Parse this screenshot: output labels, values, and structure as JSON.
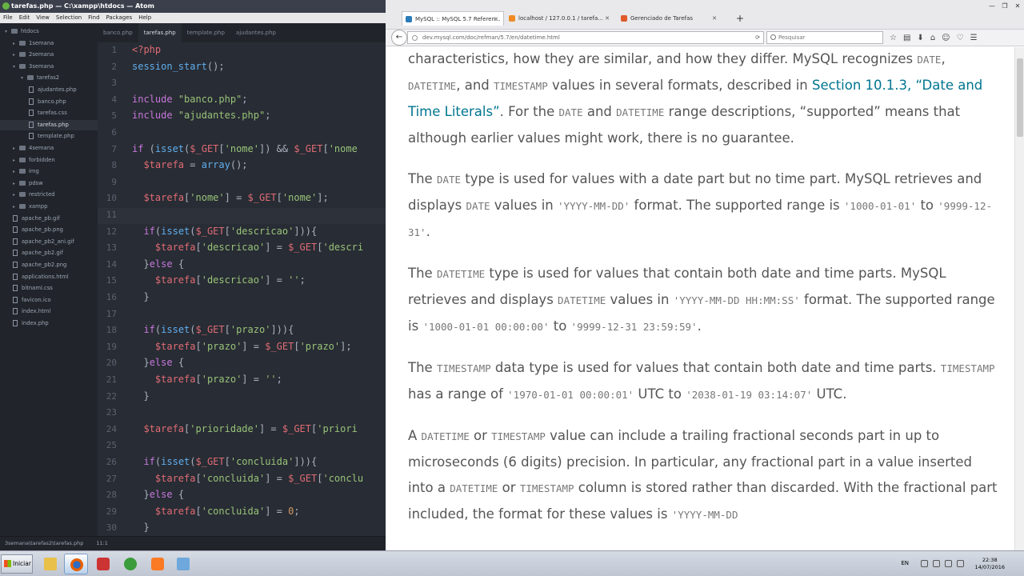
{
  "atom": {
    "title": "tarefas.php — C:\\xampp\\htdocs — Atom",
    "menu": [
      "File",
      "Edit",
      "View",
      "Selection",
      "Find",
      "Packages",
      "Help"
    ],
    "tree": [
      {
        "label": "htdocs",
        "kind": "folder",
        "open": true,
        "depth": 0
      },
      {
        "label": "1semana",
        "kind": "folder",
        "depth": 1
      },
      {
        "label": "2semana",
        "kind": "folder",
        "depth": 1
      },
      {
        "label": "3semana",
        "kind": "folder",
        "open": true,
        "depth": 1
      },
      {
        "label": "tarefas2",
        "kind": "folder",
        "open": true,
        "depth": 2
      },
      {
        "label": "ajudantes.php",
        "kind": "file",
        "depth": 3
      },
      {
        "label": "banco.php",
        "kind": "file",
        "depth": 3
      },
      {
        "label": "tarefas.css",
        "kind": "file",
        "depth": 3
      },
      {
        "label": "tarefas.php",
        "kind": "file",
        "depth": 3,
        "selected": true
      },
      {
        "label": "template.php",
        "kind": "file",
        "depth": 3
      },
      {
        "label": "4semana",
        "kind": "folder",
        "depth": 1
      },
      {
        "label": "forbidden",
        "kind": "folder",
        "depth": 1
      },
      {
        "label": "img",
        "kind": "folder",
        "depth": 1
      },
      {
        "label": "pdsw",
        "kind": "folder",
        "depth": 1
      },
      {
        "label": "restricted",
        "kind": "folder",
        "depth": 1
      },
      {
        "label": "xampp",
        "kind": "folder",
        "depth": 1
      },
      {
        "label": "apache_pb.gif",
        "kind": "file",
        "depth": 1
      },
      {
        "label": "apache_pb.png",
        "kind": "file",
        "depth": 1
      },
      {
        "label": "apache_pb2_ani.gif",
        "kind": "file",
        "depth": 1
      },
      {
        "label": "apache_pb2.gif",
        "kind": "file",
        "depth": 1
      },
      {
        "label": "apache_pb2.png",
        "kind": "file",
        "depth": 1
      },
      {
        "label": "applications.html",
        "kind": "file",
        "depth": 1
      },
      {
        "label": "bitnami.css",
        "kind": "file",
        "depth": 1
      },
      {
        "label": "favicon.ico",
        "kind": "file",
        "depth": 1
      },
      {
        "label": "index.html",
        "kind": "file",
        "depth": 1
      },
      {
        "label": "index.php",
        "kind": "file",
        "depth": 1
      }
    ],
    "tabs": [
      {
        "label": "banco.php",
        "active": false
      },
      {
        "label": "tarefas.php",
        "active": true
      },
      {
        "label": "template.php",
        "active": false
      },
      {
        "label": "ajudantes.php",
        "active": false
      }
    ],
    "code": [
      {
        "n": "1",
        "t": [
          [
            "tg",
            "<?php"
          ]
        ]
      },
      {
        "n": "2",
        "t": [
          [
            "fn",
            "session_start"
          ],
          [
            "p",
            "();"
          ]
        ]
      },
      {
        "n": "3",
        "t": []
      },
      {
        "n": "4",
        "t": [
          [
            "kw",
            "include"
          ],
          [
            "p",
            " "
          ],
          [
            "str",
            "\"banco.php\""
          ],
          [
            "p",
            ";"
          ]
        ]
      },
      {
        "n": "5",
        "t": [
          [
            "kw",
            "include"
          ],
          [
            "p",
            " "
          ],
          [
            "str",
            "\"ajudantes.php\""
          ],
          [
            "p",
            ";"
          ]
        ]
      },
      {
        "n": "6",
        "t": []
      },
      {
        "n": "7",
        "t": [
          [
            "kw",
            "if"
          ],
          [
            "p",
            " ("
          ],
          [
            "fn",
            "isset"
          ],
          [
            "p",
            "("
          ],
          [
            "var",
            "$_GET"
          ],
          [
            "p",
            "["
          ],
          [
            "str",
            "'nome'"
          ],
          [
            "p",
            "]) && "
          ],
          [
            "var",
            "$_GET"
          ],
          [
            "p",
            "["
          ],
          [
            "str",
            "'nome"
          ]
        ]
      },
      {
        "n": "8",
        "t": [
          [
            "p",
            "  "
          ],
          [
            "var",
            "$tarefa"
          ],
          [
            "p",
            " = "
          ],
          [
            "fn",
            "array"
          ],
          [
            "p",
            "();"
          ]
        ]
      },
      {
        "n": "9",
        "t": []
      },
      {
        "n": "10",
        "t": [
          [
            "p",
            "  "
          ],
          [
            "var",
            "$tarefa"
          ],
          [
            "p",
            "["
          ],
          [
            "str",
            "'nome'"
          ],
          [
            "p",
            "] = "
          ],
          [
            "var",
            "$_GET"
          ],
          [
            "p",
            "["
          ],
          [
            "str",
            "'nome'"
          ],
          [
            "p",
            "];"
          ]
        ]
      },
      {
        "n": "11",
        "t": [],
        "current": true
      },
      {
        "n": "12",
        "t": [
          [
            "p",
            "  "
          ],
          [
            "kw",
            "if"
          ],
          [
            "p",
            "("
          ],
          [
            "fn",
            "isset"
          ],
          [
            "p",
            "("
          ],
          [
            "var",
            "$_GET"
          ],
          [
            "p",
            "["
          ],
          [
            "str",
            "'descricao'"
          ],
          [
            "p",
            "])){"
          ]
        ]
      },
      {
        "n": "13",
        "t": [
          [
            "p",
            "    "
          ],
          [
            "var",
            "$tarefa"
          ],
          [
            "p",
            "["
          ],
          [
            "str",
            "'descricao'"
          ],
          [
            "p",
            "] = "
          ],
          [
            "var",
            "$_GET"
          ],
          [
            "p",
            "["
          ],
          [
            "str",
            "'descri"
          ]
        ]
      },
      {
        "n": "14",
        "t": [
          [
            "p",
            "  }"
          ],
          [
            "kw",
            "else"
          ],
          [
            "p",
            " {"
          ]
        ]
      },
      {
        "n": "15",
        "t": [
          [
            "p",
            "    "
          ],
          [
            "var",
            "$tarefa"
          ],
          [
            "p",
            "["
          ],
          [
            "str",
            "'descricao'"
          ],
          [
            "p",
            "] = "
          ],
          [
            "str",
            "''"
          ],
          [
            "p",
            ";"
          ]
        ]
      },
      {
        "n": "16",
        "t": [
          [
            "p",
            "  }"
          ]
        ]
      },
      {
        "n": "17",
        "t": []
      },
      {
        "n": "18",
        "t": [
          [
            "p",
            "  "
          ],
          [
            "kw",
            "if"
          ],
          [
            "p",
            "("
          ],
          [
            "fn",
            "isset"
          ],
          [
            "p",
            "("
          ],
          [
            "var",
            "$_GET"
          ],
          [
            "p",
            "["
          ],
          [
            "str",
            "'prazo'"
          ],
          [
            "p",
            "])){"
          ]
        ]
      },
      {
        "n": "19",
        "t": [
          [
            "p",
            "    "
          ],
          [
            "var",
            "$tarefa"
          ],
          [
            "p",
            "["
          ],
          [
            "str",
            "'prazo'"
          ],
          [
            "p",
            "] = "
          ],
          [
            "var",
            "$_GET"
          ],
          [
            "p",
            "["
          ],
          [
            "str",
            "'prazo'"
          ],
          [
            "p",
            "];"
          ]
        ]
      },
      {
        "n": "20",
        "t": [
          [
            "p",
            "  }"
          ],
          [
            "kw",
            "else"
          ],
          [
            "p",
            " {"
          ]
        ]
      },
      {
        "n": "21",
        "t": [
          [
            "p",
            "    "
          ],
          [
            "var",
            "$tarefa"
          ],
          [
            "p",
            "["
          ],
          [
            "str",
            "'prazo'"
          ],
          [
            "p",
            "] = "
          ],
          [
            "str",
            "''"
          ],
          [
            "p",
            ";"
          ]
        ]
      },
      {
        "n": "22",
        "t": [
          [
            "p",
            "  }"
          ]
        ]
      },
      {
        "n": "23",
        "t": []
      },
      {
        "n": "24",
        "t": [
          [
            "p",
            "  "
          ],
          [
            "var",
            "$tarefa"
          ],
          [
            "p",
            "["
          ],
          [
            "str",
            "'prioridade'"
          ],
          [
            "p",
            "] = "
          ],
          [
            "var",
            "$_GET"
          ],
          [
            "p",
            "["
          ],
          [
            "str",
            "'priori"
          ]
        ]
      },
      {
        "n": "25",
        "t": []
      },
      {
        "n": "26",
        "t": [
          [
            "p",
            "  "
          ],
          [
            "kw",
            "if"
          ],
          [
            "p",
            "("
          ],
          [
            "fn",
            "isset"
          ],
          [
            "p",
            "("
          ],
          [
            "var",
            "$_GET"
          ],
          [
            "p",
            "["
          ],
          [
            "str",
            "'concluida'"
          ],
          [
            "p",
            "])){"
          ]
        ]
      },
      {
        "n": "27",
        "t": [
          [
            "p",
            "    "
          ],
          [
            "var",
            "$tarefa"
          ],
          [
            "p",
            "["
          ],
          [
            "str",
            "'concluida'"
          ],
          [
            "p",
            "] = "
          ],
          [
            "var",
            "$_GET"
          ],
          [
            "p",
            "["
          ],
          [
            "str",
            "'conclu"
          ]
        ]
      },
      {
        "n": "28",
        "t": [
          [
            "p",
            "  }"
          ],
          [
            "kw",
            "else"
          ],
          [
            "p",
            " {"
          ]
        ]
      },
      {
        "n": "29",
        "t": [
          [
            "p",
            "    "
          ],
          [
            "var",
            "$tarefa"
          ],
          [
            "p",
            "["
          ],
          [
            "str",
            "'concluida'"
          ],
          [
            "p",
            "] = "
          ],
          [
            "num",
            "0"
          ],
          [
            "p",
            ";"
          ]
        ]
      },
      {
        "n": "30",
        "t": [
          [
            "p",
            "  }"
          ]
        ]
      }
    ],
    "status": {
      "path": "3semana\\tarefas2\\tarefas.php",
      "cursor": "11:1"
    }
  },
  "firefox": {
    "tabs": [
      {
        "label": "MySQL :: MySQL 5.7 Referen...",
        "active": true,
        "color": "#2b7bb9"
      },
      {
        "label": "localhost / 127.0.0.1 / tarefa...",
        "active": false,
        "color": "#f08a24"
      },
      {
        "label": "Gerenciado de Tarefas",
        "active": false,
        "color": "#e05a2b"
      }
    ],
    "new_tab": "+",
    "url": "dev.mysql.com/doc/refman/5.7/en/datetime.html",
    "search_placeholder": "Pesquisar",
    "content": {
      "p1_text1": "characteristics, how they are similar, and how they differ. MySQL recognizes ",
      "p1_c1": "DATE",
      "p1_text2": ", ",
      "p1_c2": "DATETIME",
      "p1_text3": ", and ",
      "p1_c3": "TIMESTAMP",
      "p1_text4": " values in several formats, described in ",
      "p1_link": "Section 10.1.3, “Date and Time Literals”",
      "p1_text5": ". For the ",
      "p1_c4": "DATE",
      "p1_text6": " and ",
      "p1_c5": "DATETIME",
      "p1_text7": " range descriptions, “supported” means that although earlier values might work, there is no guarantee.",
      "p2_text1": "The ",
      "p2_c1": "DATE",
      "p2_text2": " type is used for values with a date part but no time part. MySQL retrieves and displays ",
      "p2_c2": "DATE",
      "p2_text3": " values in ",
      "p2_c3": "'YYYY-MM-DD'",
      "p2_text4": " format. The supported range is ",
      "p2_c4": "'1000-01-01'",
      "p2_text5": " to ",
      "p2_c5": "'9999-12-31'",
      "p2_text6": ".",
      "p3_text1": "The ",
      "p3_c1": "DATETIME",
      "p3_text2": " type is used for values that contain both date and time parts. MySQL retrieves and displays ",
      "p3_c2": "DATETIME",
      "p3_text3": " values in ",
      "p3_c3": "'YYYY-MM-DD HH:MM:SS'",
      "p3_text4": " format. The supported range is ",
      "p3_c4": "'1000-01-01 00:00:00'",
      "p3_text5": " to ",
      "p3_c5": "'9999-12-31 23:59:59'",
      "p3_text6": ".",
      "p4_text1": "The ",
      "p4_c1": "TIMESTAMP",
      "p4_text2": " data type is used for values that contain both date and time parts. ",
      "p4_c2": "TIMESTAMP",
      "p4_text3": " has a range of ",
      "p4_c3": "'1970-01-01 00:00:01'",
      "p4_text4": " UTC to ",
      "p4_c4": "'2038-01-19 03:14:07'",
      "p4_text5": " UTC.",
      "p5_text1": "A ",
      "p5_c1": "DATETIME",
      "p5_text2": " or ",
      "p5_c2": "TIMESTAMP",
      "p5_text3": " value can include a trailing fractional seconds part in up to microseconds (6 digits) precision. In particular, any fractional part in a value inserted into a ",
      "p5_c3": "DATETIME",
      "p5_text4": " or ",
      "p5_c4": "TIMESTAMP",
      "p5_text5": " column is stored rather than discarded. With the fractional part included, the format for these values is ",
      "p5_c5": "'YYYY-MM-DD"
    }
  },
  "taskbar": {
    "start_label": "Iniciar",
    "lang": "EN",
    "time": "22:38",
    "date": "14/07/2016"
  }
}
